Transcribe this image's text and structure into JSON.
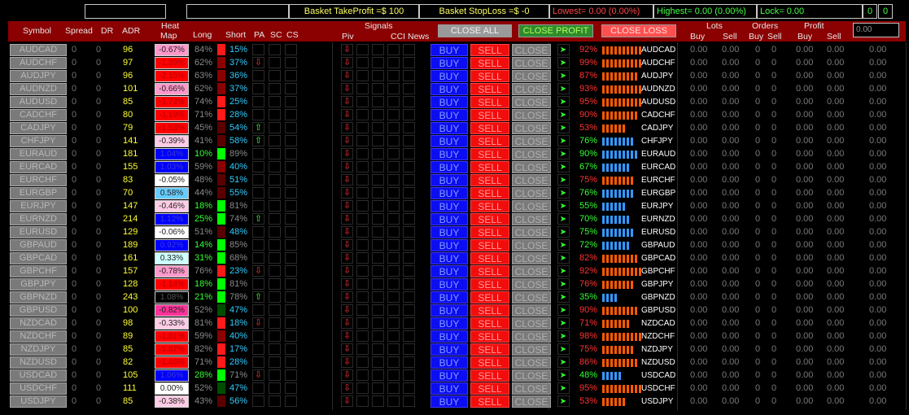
{
  "top_bar": {
    "take_profit": "Basket TakeProfit =$ 100",
    "stop_loss": "Basket StopLoss =$ -0",
    "lowest": "Lowest= 0.00 (0.00%)",
    "highest": "Highest= 0.00 (0.00%)",
    "lock": "Lock= 0.00",
    "counter_a": "0",
    "counter_b": "0"
  },
  "colors": {
    "header_bg": "#8b0000",
    "buy": "#0d0df2",
    "sell": "#f20d0d",
    "adr": "#ffff33",
    "positive": "#00bfff",
    "negative": "#ff3333"
  },
  "header": {
    "symbol": "Symbol",
    "spread": "Spread",
    "dr": "DR",
    "adr": "ADR",
    "heat_1": "Heat",
    "heat_2": "Map",
    "long": "Long",
    "short": "Short",
    "pa": "PA",
    "sc": "SC",
    "cs": "CS",
    "signals": "Signals",
    "piv": "Piv",
    "cci_news": "CCI News",
    "close_all": "CLOSE ALL",
    "close_profit": "CLOSE PROFIT",
    "close_loss": "CLOSE LOSS",
    "lots": "Lots",
    "orders": "Orders",
    "profit": "Profit",
    "buy": "Buy",
    "sell": "Sell",
    "input_value": "0.00"
  },
  "labels": {
    "buy": "BUY",
    "sell": "SELL",
    "close": "CLOSE",
    "zero": "0",
    "zero_dec": "0.00"
  },
  "rows": [
    {
      "symbol": "AUDCAD",
      "spread": "0",
      "dr": "0",
      "adr": "96",
      "heat": "-0.67%",
      "heat_color": "#ff99cc",
      "long": "84%",
      "long_color": "#ff1a1a",
      "short": "15%",
      "pa": "",
      "piv": "down",
      "pct": "92%",
      "pct_color": "#ff3333",
      "bar_count": 10,
      "bar_color": "#ff5a00",
      "pair": "AUDCAD"
    },
    {
      "symbol": "AUDCHF",
      "spread": "0",
      "dr": "0",
      "adr": "97",
      "heat": "-1.89%",
      "heat_color": "#ff0000",
      "long": "62%",
      "long_color": "#8b0000",
      "short": "37%",
      "pa": "down",
      "piv": "down",
      "pct": "99%",
      "pct_color": "#ff3333",
      "bar_count": 10,
      "bar_color": "#ff5a00",
      "pair": "AUDCHF"
    },
    {
      "symbol": "AUDJPY",
      "spread": "0",
      "dr": "0",
      "adr": "96",
      "heat": "-2.15%",
      "heat_color": "#ff0000",
      "long": "63%",
      "long_color": "#8b0000",
      "short": "36%",
      "pa": "",
      "piv": "down",
      "pct": "87%",
      "pct_color": "#ff3333",
      "bar_count": 9,
      "bar_color": "#ff5a00",
      "pair": "AUDJPY"
    },
    {
      "symbol": "AUDNZD",
      "spread": "0",
      "dr": "0",
      "adr": "101",
      "heat": "-0.66%",
      "heat_color": "#ff99cc",
      "long": "62%",
      "long_color": "#8b0000",
      "short": "37%",
      "pa": "",
      "piv": "down",
      "pct": "93%",
      "pct_color": "#ff3333",
      "bar_count": 10,
      "bar_color": "#ff5a00",
      "pair": "AUDNZD"
    },
    {
      "symbol": "AUDUSD",
      "spread": "0",
      "dr": "0",
      "adr": "85",
      "heat": "-1.73%",
      "heat_color": "#ff0000",
      "long": "74%",
      "long_color": "#ff1a1a",
      "short": "25%",
      "pa": "",
      "piv": "down",
      "pct": "95%",
      "pct_color": "#ff3333",
      "bar_count": 10,
      "bar_color": "#ff5a00",
      "pair": "AUDUSD"
    },
    {
      "symbol": "CADCHF",
      "spread": "0",
      "dr": "0",
      "adr": "80",
      "heat": "-1.19%",
      "heat_color": "#ff0000",
      "long": "71%",
      "long_color": "#ff1a1a",
      "short": "28%",
      "pa": "",
      "piv": "down",
      "pct": "90%",
      "pct_color": "#ff3333",
      "bar_count": 9,
      "bar_color": "#ff5a00",
      "pair": "CADCHF"
    },
    {
      "symbol": "CADJPY",
      "spread": "0",
      "dr": "0",
      "adr": "79",
      "heat": "-1.53%",
      "heat_color": "#ff0000",
      "long": "45%",
      "long_color": "#5a0000",
      "short": "54%",
      "pa": "up",
      "piv": "down",
      "pct": "53%",
      "pct_color": "#ff3333",
      "bar_count": 6,
      "bar_color": "#ff5a00",
      "pair": "CADJPY"
    },
    {
      "symbol": "CHFJPY",
      "spread": "0",
      "dr": "0",
      "adr": "141",
      "heat": "-0.39%",
      "heat_color": "#ffcce6",
      "long": "41%",
      "long_color": "#5a0000",
      "short": "58%",
      "pa": "up",
      "piv": "down",
      "pct": "76%",
      "pct_color": "#33ff33",
      "bar_count": 8,
      "bar_color": "#3399ff",
      "pair": "CHFJPY"
    },
    {
      "symbol": "EURAUD",
      "spread": "0",
      "dr": "0",
      "adr": "181",
      "heat": "1.04%",
      "heat_color": "#0000ff",
      "long": "10%",
      "long_color": "#00ff00",
      "short": "89%",
      "pa": "",
      "piv": "down",
      "pct": "90%",
      "pct_color": "#33ff33",
      "bar_count": 9,
      "bar_color": "#3399ff",
      "pair": "EURAUD"
    },
    {
      "symbol": "EURCAD",
      "spread": "0",
      "dr": "0",
      "adr": "155",
      "heat": "1.03%",
      "heat_color": "#0000ff",
      "long": "59%",
      "long_color": "#8b0000",
      "short": "40%",
      "pa": "",
      "piv": "down",
      "pct": "67%",
      "pct_color": "#33ff33",
      "bar_count": 7,
      "bar_color": "#3399ff",
      "pair": "EURCAD"
    },
    {
      "symbol": "EURCHF",
      "spread": "0",
      "dr": "0",
      "adr": "83",
      "heat": "-0.05%",
      "heat_color": "#ffffff",
      "long": "48%",
      "long_color": "#5a0000",
      "short": "51%",
      "pa": "",
      "piv": "down",
      "pct": "75%",
      "pct_color": "#ff3333",
      "bar_count": 8,
      "bar_color": "#ff5a00",
      "pair": "EURCHF"
    },
    {
      "symbol": "EURGBP",
      "spread": "0",
      "dr": "0",
      "adr": "70",
      "heat": "0.58%",
      "heat_color": "#66ccff",
      "long": "44%",
      "long_color": "#5a0000",
      "short": "55%",
      "pa": "",
      "piv": "down",
      "pct": "76%",
      "pct_color": "#33ff33",
      "bar_count": 8,
      "bar_color": "#3399ff",
      "pair": "EURGBP"
    },
    {
      "symbol": "EURJPY",
      "spread": "0",
      "dr": "0",
      "adr": "147",
      "heat": "-0.46%",
      "heat_color": "#ffcce6",
      "long": "18%",
      "long_color": "#00ff00",
      "short": "81%",
      "pa": "",
      "piv": "down",
      "pct": "55%",
      "pct_color": "#33ff33",
      "bar_count": 6,
      "bar_color": "#3399ff",
      "pair": "EURJPY"
    },
    {
      "symbol": "EURNZD",
      "spread": "0",
      "dr": "0",
      "adr": "214",
      "heat": "1.12%",
      "heat_color": "#0000ff",
      "long": "25%",
      "long_color": "#00ff00",
      "short": "74%",
      "pa": "up",
      "piv": "down",
      "pct": "70%",
      "pct_color": "#33ff33",
      "bar_count": 7,
      "bar_color": "#3399ff",
      "pair": "EURNZD"
    },
    {
      "symbol": "EURUSD",
      "spread": "0",
      "dr": "0",
      "adr": "129",
      "heat": "-0.06%",
      "heat_color": "#ffffff",
      "long": "51%",
      "long_color": "#5a0000",
      "short": "48%",
      "pa": "",
      "piv": "down",
      "pct": "75%",
      "pct_color": "#33ff33",
      "bar_count": 8,
      "bar_color": "#3399ff",
      "pair": "EURUSD"
    },
    {
      "symbol": "GBPAUD",
      "spread": "0",
      "dr": "0",
      "adr": "189",
      "heat": "0.92%",
      "heat_color": "#0000ff",
      "long": "14%",
      "long_color": "#00ff00",
      "short": "85%",
      "pa": "",
      "piv": "down",
      "pct": "72%",
      "pct_color": "#33ff33",
      "bar_count": 7,
      "bar_color": "#3399ff",
      "pair": "GBPAUD"
    },
    {
      "symbol": "GBPCAD",
      "spread": "0",
      "dr": "0",
      "adr": "161",
      "heat": "0.33%",
      "heat_color": "#ccffff",
      "long": "31%",
      "long_color": "#00ff00",
      "short": "68%",
      "pa": "",
      "piv": "down",
      "pct": "82%",
      "pct_color": "#ff3333",
      "bar_count": 9,
      "bar_color": "#ff5a00",
      "pair": "GBPCAD"
    },
    {
      "symbol": "GBPCHF",
      "spread": "0",
      "dr": "0",
      "adr": "157",
      "heat": "-0.78%",
      "heat_color": "#ff99cc",
      "long": "76%",
      "long_color": "#ff1a1a",
      "short": "23%",
      "pa": "down",
      "piv": "down",
      "pct": "92%",
      "pct_color": "#ff3333",
      "bar_count": 10,
      "bar_color": "#ff5a00",
      "pair": "GBPCHF"
    },
    {
      "symbol": "GBPJPY",
      "spread": "0",
      "dr": "0",
      "adr": "128",
      "heat": "-1.14%",
      "heat_color": "#ff0000",
      "long": "18%",
      "long_color": "#00ff00",
      "short": "81%",
      "pa": "",
      "piv": "down",
      "pct": "76%",
      "pct_color": "#ff3333",
      "bar_count": 8,
      "bar_color": "#ff5a00",
      "pair": "GBPJPY"
    },
    {
      "symbol": "GBPNZD",
      "spread": "0",
      "dr": "0",
      "adr": "243",
      "heat": "1.08%",
      "heat_color": "#000000",
      "long": "21%",
      "long_color": "#00ff00",
      "short": "78%",
      "pa": "up",
      "piv": "down",
      "pct": "35%",
      "pct_color": "#33ff33",
      "bar_count": 4,
      "bar_color": "#3399ff",
      "pair": "GBPNZD"
    },
    {
      "symbol": "GBPUSD",
      "spread": "0",
      "dr": "0",
      "adr": "100",
      "heat": "-0.82%",
      "heat_color": "#ff3399",
      "long": "52%",
      "long_color": "#004d00",
      "short": "47%",
      "pa": "",
      "piv": "down",
      "pct": "90%",
      "pct_color": "#ff3333",
      "bar_count": 9,
      "bar_color": "#ff5a00",
      "pair": "GBPUSD"
    },
    {
      "symbol": "NZDCAD",
      "spread": "0",
      "dr": "0",
      "adr": "98",
      "heat": "-0.33%",
      "heat_color": "#ffcce6",
      "long": "81%",
      "long_color": "#ff1a1a",
      "short": "18%",
      "pa": "down",
      "piv": "down",
      "pct": "71%",
      "pct_color": "#ff3333",
      "bar_count": 7,
      "bar_color": "#ff5a00",
      "pair": "NZDCAD"
    },
    {
      "symbol": "NZDCHF",
      "spread": "0",
      "dr": "0",
      "adr": "89",
      "heat": "-1.81%",
      "heat_color": "#ff0000",
      "long": "59%",
      "long_color": "#8b0000",
      "short": "40%",
      "pa": "",
      "piv": "down",
      "pct": "98%",
      "pct_color": "#ff3333",
      "bar_count": 10,
      "bar_color": "#ff5a00",
      "pair": "NZDCHF"
    },
    {
      "symbol": "NZDJPY",
      "spread": "0",
      "dr": "0",
      "adr": "85",
      "heat": "-1.87%",
      "heat_color": "#ff0000",
      "long": "82%",
      "long_color": "#ff1a1a",
      "short": "17%",
      "pa": "",
      "piv": "down",
      "pct": "75%",
      "pct_color": "#ff3333",
      "bar_count": 8,
      "bar_color": "#ff5a00",
      "pair": "NZDJPY"
    },
    {
      "symbol": "NZDUSD",
      "spread": "0",
      "dr": "0",
      "adr": "82",
      "heat": "-1.46%",
      "heat_color": "#ff0000",
      "long": "71%",
      "long_color": "#ff1a1a",
      "short": "28%",
      "pa": "",
      "piv": "down",
      "pct": "86%",
      "pct_color": "#ff3333",
      "bar_count": 9,
      "bar_color": "#ff5a00",
      "pair": "NZDUSD"
    },
    {
      "symbol": "USDCAD",
      "spread": "0",
      "dr": "0",
      "adr": "105",
      "heat": "1.06%",
      "heat_color": "#0000ff",
      "long": "28%",
      "long_color": "#00ff00",
      "short": "71%",
      "pa": "down",
      "piv": "down",
      "pct": "48%",
      "pct_color": "#33ff33",
      "bar_count": 5,
      "bar_color": "#3399ff",
      "pair": "USDCAD"
    },
    {
      "symbol": "USDCHF",
      "spread": "0",
      "dr": "0",
      "adr": "111",
      "heat": "0.00%",
      "heat_color": "#ffffff",
      "long": "52%",
      "long_color": "#004d00",
      "short": "47%",
      "pa": "",
      "piv": "down",
      "pct": "95%",
      "pct_color": "#ff3333",
      "bar_count": 10,
      "bar_color": "#ff5a00",
      "pair": "USDCHF"
    },
    {
      "symbol": "USDJPY",
      "spread": "0",
      "dr": "0",
      "adr": "85",
      "heat": "-0.38%",
      "heat_color": "#ffcce6",
      "long": "43%",
      "long_color": "#5a0000",
      "short": "56%",
      "pa": "",
      "piv": "down",
      "pct": "53%",
      "pct_color": "#ff3333",
      "bar_count": 6,
      "bar_color": "#ff5a00",
      "pair": "USDJPY"
    }
  ]
}
